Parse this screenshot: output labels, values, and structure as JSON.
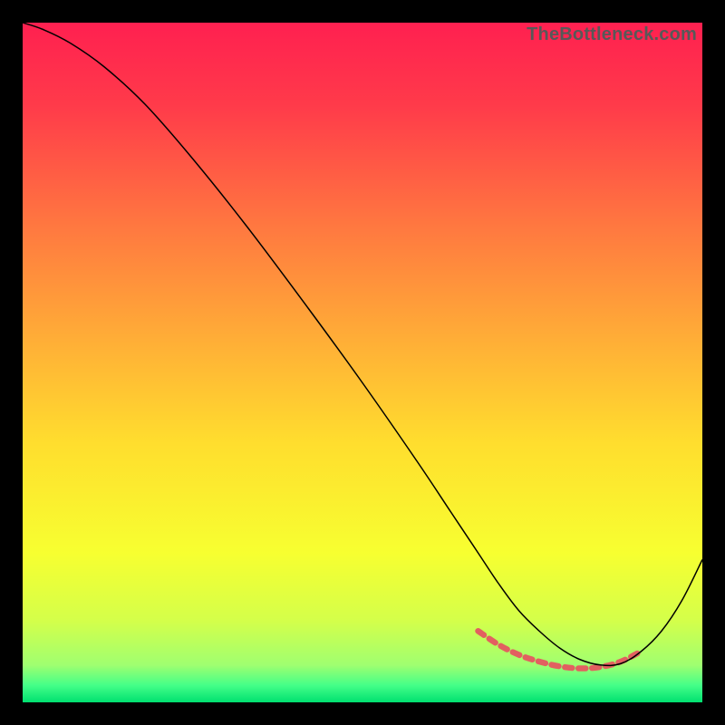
{
  "watermark": "TheBottleneck.com",
  "chart_data": {
    "type": "line",
    "title": "",
    "xlabel": "",
    "ylabel": "",
    "xlim": [
      0,
      100
    ],
    "ylim": [
      0,
      100
    ],
    "grid": false,
    "legend": false,
    "background_gradient": {
      "stops": [
        {
          "offset": 0.0,
          "color": "#ff2050"
        },
        {
          "offset": 0.12,
          "color": "#ff3a4a"
        },
        {
          "offset": 0.3,
          "color": "#ff7840"
        },
        {
          "offset": 0.48,
          "color": "#ffb236"
        },
        {
          "offset": 0.62,
          "color": "#ffde2e"
        },
        {
          "offset": 0.78,
          "color": "#f7ff30"
        },
        {
          "offset": 0.88,
          "color": "#d4ff4a"
        },
        {
          "offset": 0.945,
          "color": "#a0ff70"
        },
        {
          "offset": 0.975,
          "color": "#44ff88"
        },
        {
          "offset": 1.0,
          "color": "#00e070"
        }
      ]
    },
    "series": [
      {
        "name": "curve",
        "stroke": "#000000",
        "stroke_width": 1.5,
        "x": [
          0,
          3,
          7,
          12,
          18,
          25,
          33,
          42,
          50,
          58,
          63,
          67,
          70,
          73,
          76,
          79,
          82,
          85,
          88,
          91,
          94,
          97,
          100
        ],
        "y": [
          100,
          99.0,
          97.0,
          93.5,
          88.0,
          80.0,
          70.0,
          58.0,
          47.0,
          35.5,
          28.0,
          22.0,
          17.5,
          13.5,
          10.5,
          8.0,
          6.3,
          5.5,
          5.7,
          7.5,
          10.5,
          15.0,
          21.0
        ]
      }
    ],
    "dashed_segment": {
      "stroke": "#e26060",
      "stroke_width": 6.5,
      "dash": "8 7",
      "x": [
        67,
        70,
        73,
        76,
        79,
        82,
        85,
        88,
        91
      ],
      "y": [
        10.5,
        8.5,
        7.0,
        6.0,
        5.3,
        5.0,
        5.2,
        6.0,
        7.5
      ]
    }
  }
}
